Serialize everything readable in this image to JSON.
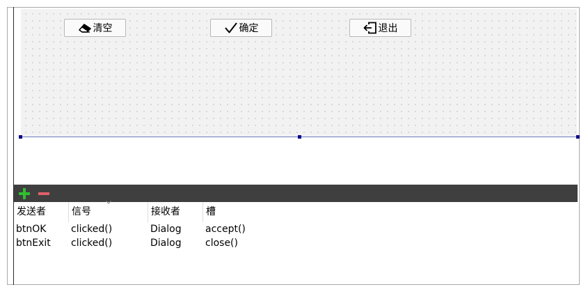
{
  "buttons": {
    "clear_label": "清空",
    "ok_label": "确定",
    "exit_label": "退出"
  },
  "icons": {
    "clear": "eraser-icon",
    "ok": "checkmark-icon",
    "exit": "exit-door-icon",
    "add": "plus-icon",
    "remove": "minus-icon"
  },
  "colors": {
    "toolbar_bg": "#3f3f3f",
    "add_icon": "#2fbf2f",
    "remove_icon": "#e0606a",
    "selection_handle": "#0a0a8a"
  },
  "connections": {
    "headers": [
      "发送者",
      "信号",
      "接收者",
      "槽"
    ],
    "rows": [
      [
        "btnOK",
        "clicked()",
        "Dialog",
        "accept()"
      ],
      [
        "btnExit",
        "clicked()",
        "Dialog",
        "close()"
      ]
    ]
  }
}
